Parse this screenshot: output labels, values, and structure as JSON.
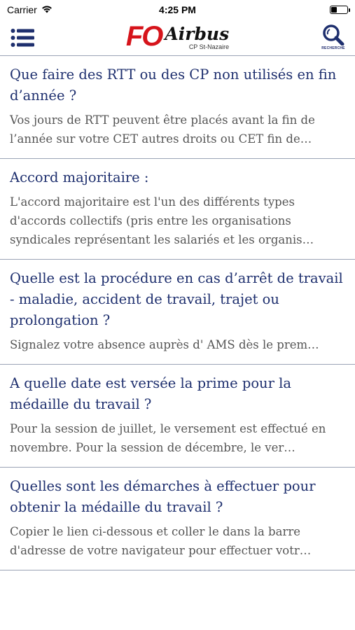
{
  "status_bar": {
    "carrier": "Carrier",
    "time": "4:25 PM",
    "battery_level": 0.4
  },
  "header": {
    "menu_icon": "menu-icon",
    "logo_fo": "FO",
    "logo_airbus": "Airbus",
    "logo_sub": "CP St-Nazaire",
    "search_icon": "search-icon",
    "search_label": "RECHERCHE",
    "brand_color": "#1e2f6e",
    "logo_red": "#d6141b"
  },
  "articles": [
    {
      "title": "Que faire des RTT ou des CP non utilisés en fin d’année ?",
      "excerpt": "Vos jours de RTT peuvent être placés avant la fin de l’année sur votre CET autres droits ou CET fin de…"
    },
    {
      "title": "Accord majoritaire :",
      "excerpt": "L'accord majoritaire est l'un des différents types d'accords collectifs (pris entre les organisations syndicales représentant les salariés et les organis…"
    },
    {
      "title": " Quelle est la procédure en cas d’arrêt de travail - maladie, accident de travail, trajet ou prolongation ?",
      "excerpt": "Signalez votre absence auprès d' AMS dès le prem…"
    },
    {
      "title": "A quelle date est versée la prime pour la médaille du travail ?",
      "excerpt": "Pour la session de juillet, le versement est effectué en novembre. Pour la session de décembre, le ver…"
    },
    {
      "title": "Quelles sont les démarches à effectuer pour obtenir la médaille du travail ?",
      "excerpt": "Copier le lien ci-dessous et coller le dans la barre d'adresse de votre navigateur pour effectuer votr…"
    }
  ]
}
